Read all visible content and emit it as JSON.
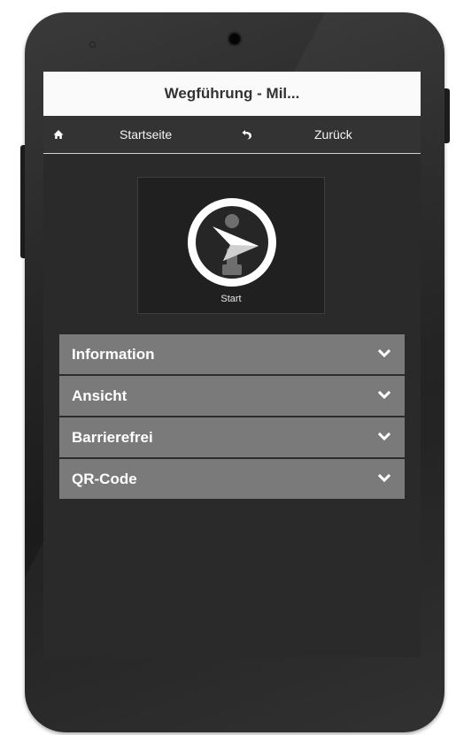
{
  "title_bar": {
    "title": "Wegführung - Mil..."
  },
  "nav_bar": {
    "home_label": "Startseite",
    "back_label": "Zurück"
  },
  "start_tile": {
    "label": "Start"
  },
  "accordion": {
    "items": [
      {
        "label": "Information"
      },
      {
        "label": "Ansicht"
      },
      {
        "label": "Barrierefrei"
      },
      {
        "label": "QR-Code"
      }
    ]
  },
  "colors": {
    "title_bar_bg": "#fafafa",
    "nav_bar_bg": "#333333",
    "screen_bg": "#2a2a2a",
    "accordion_bg": "#7a7a7a",
    "phone_body": "#262626"
  },
  "icons": [
    "home-icon",
    "back-arrow-icon",
    "start-navigation-icon",
    "chevron-down-icon"
  ]
}
